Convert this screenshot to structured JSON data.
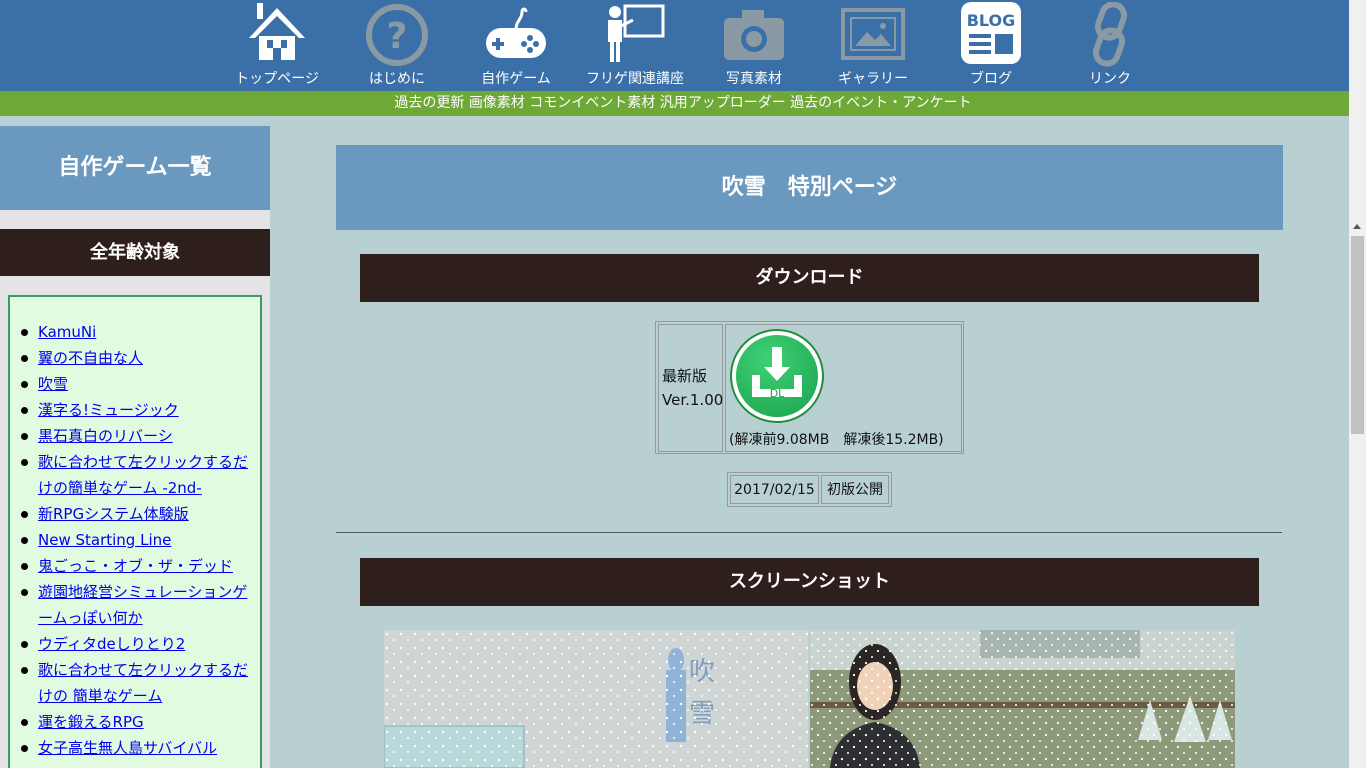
{
  "nav": {
    "items": [
      {
        "label": "トップページ",
        "icon": "house-icon"
      },
      {
        "label": "はじめに",
        "icon": "question-icon"
      },
      {
        "label": "自作ゲーム",
        "icon": "gamepad-icon"
      },
      {
        "label": "フリゲ関連講座",
        "icon": "teacher-icon"
      },
      {
        "label": "写真素材",
        "icon": "camera-icon"
      },
      {
        "label": "ギャラリー",
        "icon": "picture-frame-icon"
      },
      {
        "label": "ブログ",
        "icon": "blog-icon"
      },
      {
        "label": "リンク",
        "icon": "link-icon"
      }
    ],
    "blog_icon_text": "BLOG"
  },
  "subnav": {
    "links": [
      "過去の更新",
      "画像素材",
      "コモンイベント素材",
      "汎用アップローダー",
      "過去のイベント・アンケート"
    ]
  },
  "sidebar": {
    "title": "自作ゲーム一覧",
    "category": "全年齢対象",
    "games": [
      "KamuNi",
      "翼の不自由な人",
      "吹雪",
      "漢字る!ミュージック",
      "黒石真白のリバーシ",
      "歌に合わせて左クリックするだけの簡単なゲーム -2nd-",
      "新RPGシステム体験版",
      "New Starting Line",
      "鬼ごっこ・オブ・ザ・デッド",
      "遊園地経営シミュレーションゲームっぽい何か",
      "ウディタdeしりとり2",
      "歌に合わせて左クリックするだけの 簡単なゲーム",
      "運を鍛えるRPG",
      "女子高生無人島サバイバル"
    ]
  },
  "main": {
    "title": "吹雪　特別ページ",
    "download": {
      "heading": "ダウンロード",
      "label_line1": "最新版",
      "label_line2": "Ver.1.00",
      "button_text": "DL",
      "size_text": "(解凍前9.08MB　解凍後15.2MB)"
    },
    "release": {
      "date": "2017/02/15",
      "note": "初版公開"
    },
    "screenshots": {
      "heading": "スクリーンショット",
      "title_art": "吹雪"
    }
  },
  "colors": {
    "nav_bg": "#3a6fa8",
    "subnav_bg": "#6ea836",
    "page_bg": "#b9d0d3",
    "heading_bg": "#6a98be",
    "section_bg": "#2f1f1c",
    "list_bg": "#e1fbe1",
    "dl_green": "#1aa24d"
  }
}
